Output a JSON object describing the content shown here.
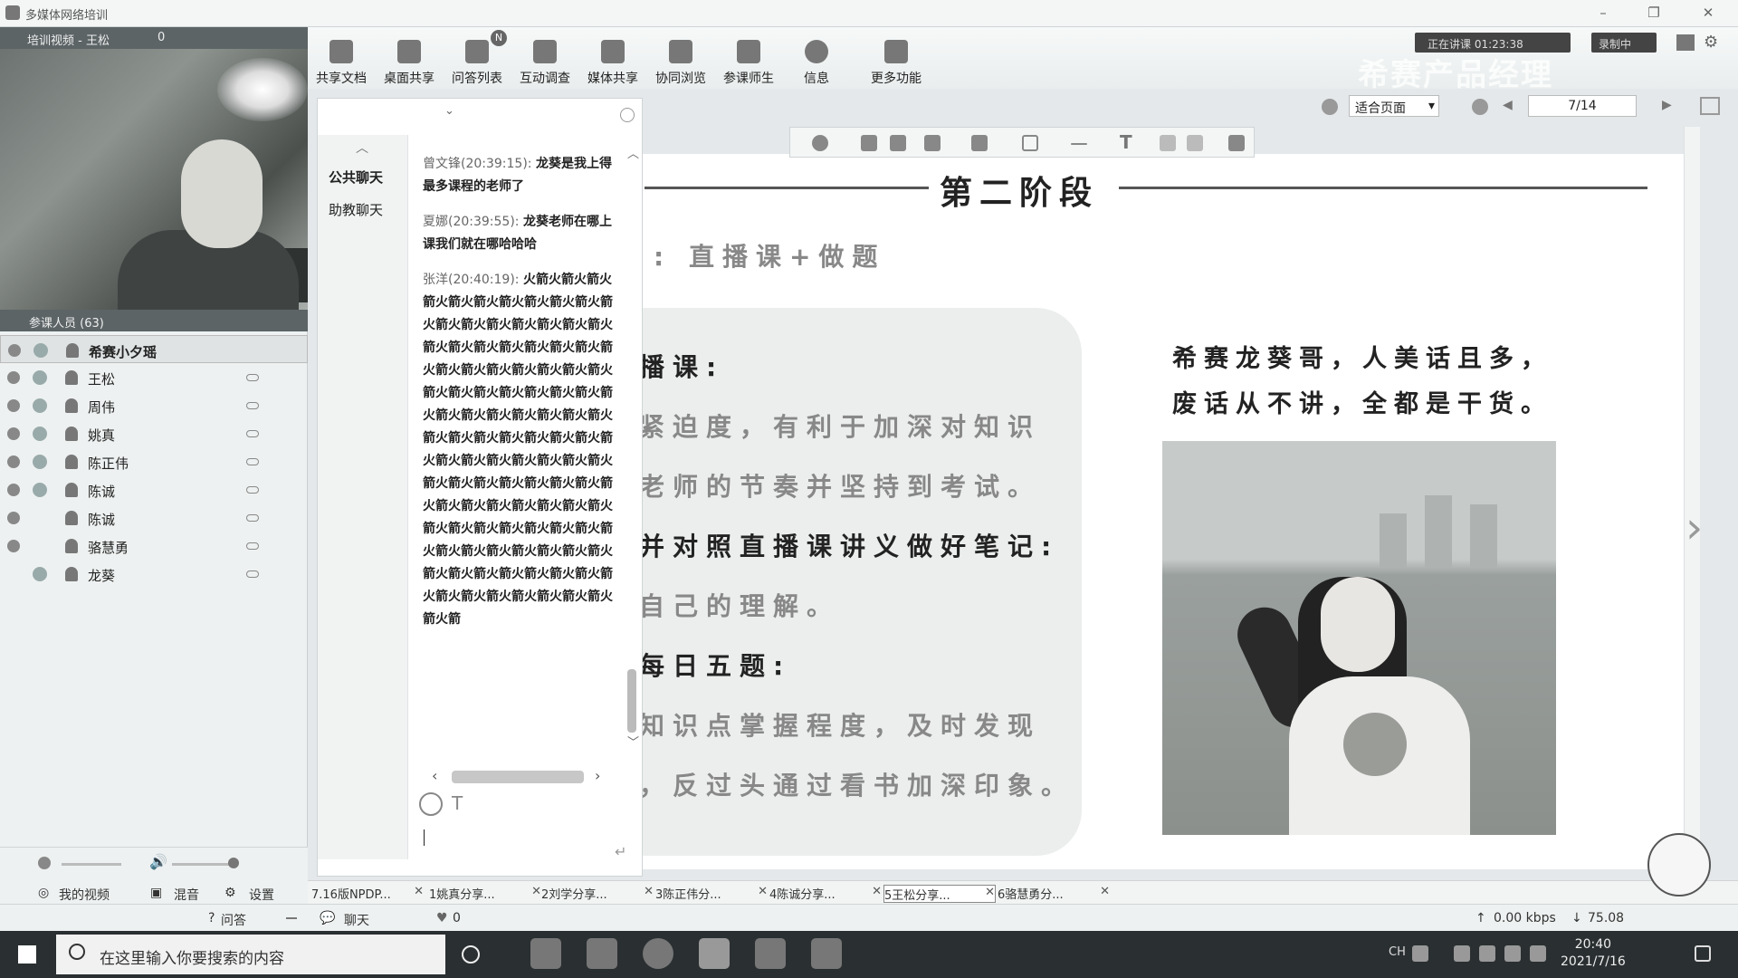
{
  "window": {
    "title": "多媒体网络培训"
  },
  "video_panel": {
    "header": "培训视频 - 王松",
    "count": "0"
  },
  "participants": {
    "header": "参课人员 (63)",
    "items": [
      "希赛小夕瑶",
      "王松",
      "周伟",
      "姚真",
      "陈正伟",
      "陈诚",
      "陈诚",
      "骆慧勇",
      "龙葵"
    ]
  },
  "left_controls": {
    "my_video": "我的视频",
    "mix": "混音",
    "settings": "设置"
  },
  "toolbar": {
    "items": [
      "共享文档",
      "桌面共享",
      "问答列表",
      "互动调查",
      "媒体共享",
      "协同浏览",
      "参课师生",
      "信息",
      "更多功能"
    ],
    "badge": "N",
    "status": "正在讲课 01:23:38",
    "record": "录制中",
    "watermark": "希赛产品经理"
  },
  "chat": {
    "tabs": [
      "公共聊天",
      "助教聊天"
    ],
    "messages": [
      {
        "who": "曾文锋(20:39:15):",
        "text": "龙葵是我上得最多课程的老师了"
      },
      {
        "who": "夏娜(20:39:55):",
        "text": "龙葵老师在哪上课我们就在哪哈哈哈"
      },
      {
        "who": "张洋(20:40:19):",
        "text": "火箭火箭火箭火箭火箭火箭火箭火箭火箭火箭火箭火箭火箭火箭火箭火箭火箭火箭火箭火箭火箭火箭火箭火箭火箭火箭火箭火箭火箭火箭火箭火箭火箭火箭火箭火箭火箭火箭火箭火箭火箭火箭火箭火箭火箭火箭火箭火箭火箭火箭火箭火箭火箭火箭火箭火箭火箭火箭火箭火箭火箭火箭火箭火箭火箭火箭火箭火箭火箭火箭火箭火箭火箭火箭火箭火箭火箭火箭火箭火箭火箭火箭火箭火箭火箭火箭火箭火箭火箭火箭火箭火箭火箭火箭火箭火箭火箭火箭火箭火箭火箭火箭火箭火箭火箭火箭火箭火箭火箭火箭"
      }
    ]
  },
  "viewer": {
    "zoom": "适合页面",
    "page": "7/14"
  },
  "slide": {
    "title": "第二阶段",
    "subtitle": ": 直播课+做题",
    "lines": [
      "播课:",
      "紧迫度，有利于加深对知识",
      "老师的节奏并坚持到考试。",
      "并对照直播课讲义做好笔记:",
      "自己的理解。",
      "每日五题:",
      "知识点掌握程度，及时发现",
      "，反过头通过看书加深印象。"
    ],
    "right_text": [
      "希赛龙葵哥，人美话且多，",
      "废话从不讲，全都是干货。"
    ]
  },
  "doc_tabs": [
    "7.16版NPDP...",
    "1姚真分享...",
    "2刘学分享...",
    "3陈正伟分...",
    "4陈诚分享...",
    "5王松分享...",
    "6骆慧勇分..."
  ],
  "bottom": {
    "qa": "问答",
    "chat": "聊天",
    "likes": "0",
    "up": "0.00 kbps",
    "down": "75.08"
  },
  "taskbar": {
    "search_placeholder": "在这里输入你要搜索的内容",
    "ime": "CH",
    "time": "20:40",
    "date": "2021/7/16"
  }
}
